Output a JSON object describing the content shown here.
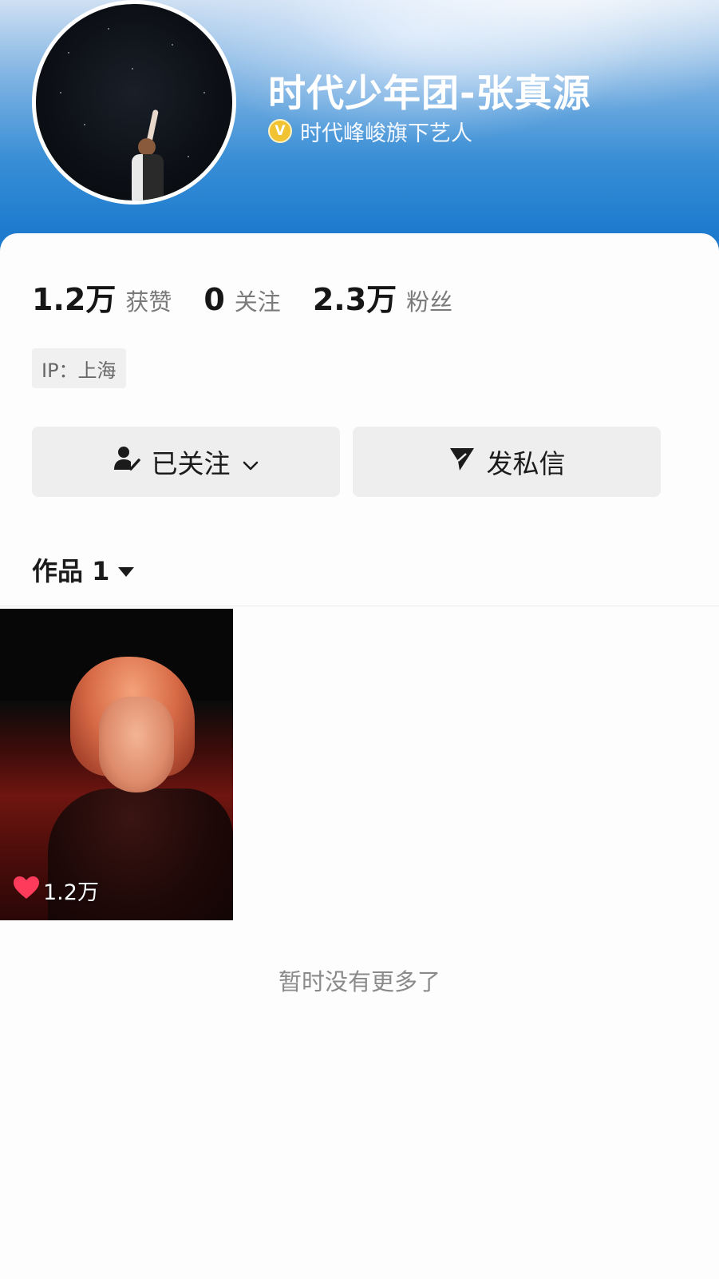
{
  "profile": {
    "name": "时代少年团-张真源",
    "verification": "时代峰峻旗下艺人"
  },
  "stats": [
    {
      "value": "1.2万",
      "label": "获赞"
    },
    {
      "value": "0",
      "label": "关注"
    },
    {
      "value": "2.3万",
      "label": "粉丝"
    }
  ],
  "ip_location": "IP：上海",
  "buttons": {
    "follow": "已关注",
    "message": "发私信"
  },
  "works_tab": {
    "label": "作品 1"
  },
  "works": [
    {
      "likes": "1.2万"
    }
  ],
  "footer": {
    "no_more": "暂时没有更多了"
  },
  "colors": {
    "banner_blue": "#1f7dcf",
    "verify_gold": "#f1c232",
    "like_red": "#ff3b5c",
    "button_bg": "#eeeeee"
  },
  "icons": {
    "verify": "verified-badge-icon",
    "follow": "user-check-icon",
    "dropdown": "chevron-down-icon",
    "message": "send-icon",
    "tab_dropdown": "caret-down-icon",
    "like": "heart-icon"
  }
}
